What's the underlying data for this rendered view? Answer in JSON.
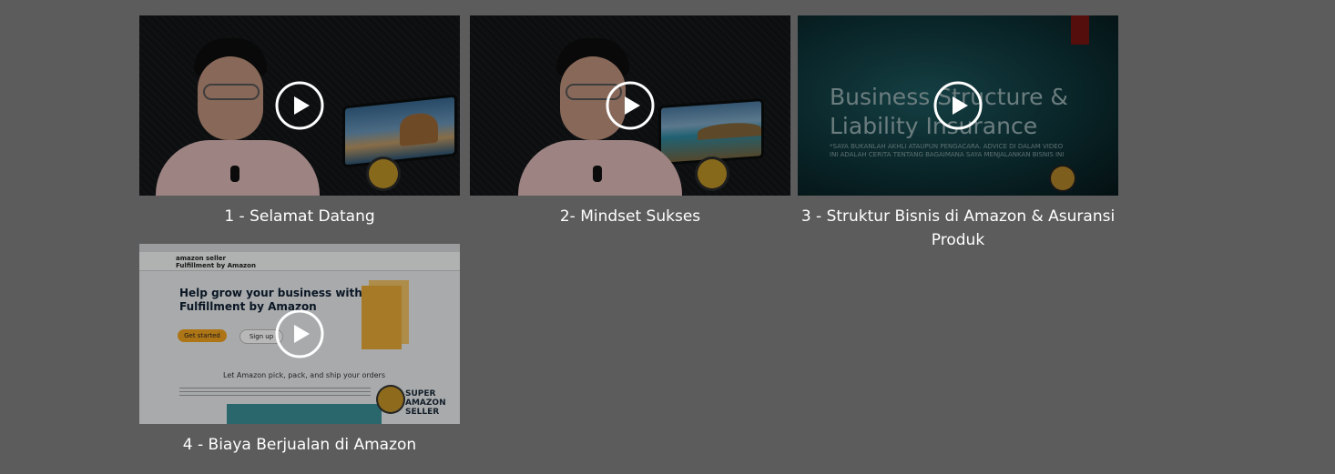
{
  "videos": [
    {
      "title": "1 - Selamat Datang",
      "thumbnail_icon": "presenter-video-thumbnail"
    },
    {
      "title": "2- Mindset Sukses",
      "thumbnail_icon": "presenter-video-thumbnail"
    },
    {
      "title": "3 - Struktur Bisnis di Amazon & Asuransi Produk",
      "thumbnail_icon": "slide-thumbnail",
      "slide": {
        "heading": "Business Structure & Liability Insurance",
        "note": "*SAYA BUKANLAH AKHLI ATAUPUN PENGACARA. ADVICE DI DALAM VIDEO INI ADALAH CERITA TENTANG BAGAIMANA SAYA MENJALANKAN BISNIS INI"
      }
    },
    {
      "title": "4 - Biaya Berjualan di Amazon",
      "thumbnail_icon": "amazon-fba-page-thumbnail",
      "page": {
        "brand": "amazon seller",
        "nav": "Fulfillment by Amazon",
        "hero": "Help grow your business with Fulfillment by Amazon",
        "primary_cta": "Get started",
        "secondary_cta": "Sign up",
        "subheading": "Let Amazon pick, pack, and ship your orders",
        "badge": "SUPER AMAZON SELLER"
      }
    }
  ],
  "play_icon": "play-circle-icon",
  "colors": {
    "background": "#5c5c5c",
    "title_text": "#ffffff"
  }
}
